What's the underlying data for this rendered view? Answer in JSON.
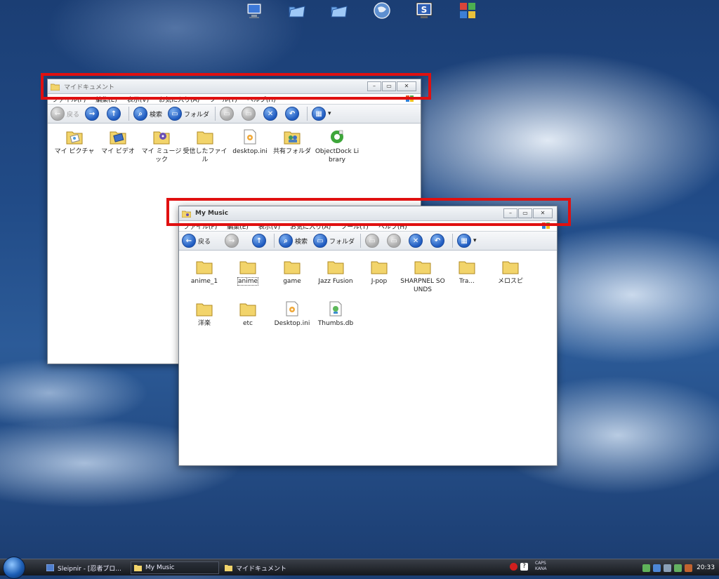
{
  "desktop": {
    "icons": [
      "computer-icon",
      "folder-blue-icon",
      "folder-blue-icon",
      "globe-icon",
      "app-s-icon",
      "apps-grid-icon"
    ]
  },
  "window_mydocs": {
    "title": "マイドキュメント",
    "menu": [
      "ファイル(F)",
      "編集(E)",
      "表示(V)",
      "お気に入り(A)",
      "ツール(T)",
      "ヘルプ(H)"
    ],
    "toolbar": {
      "back": "戻る",
      "search": "検索",
      "folders": "フォルダ"
    },
    "files": [
      {
        "name": "マイ ピクチャ",
        "icon": "pictures-folder-icon"
      },
      {
        "name": "マイ ビデオ",
        "icon": "videos-folder-icon"
      },
      {
        "name": "マイ ミュージック",
        "icon": "music-folder-icon"
      },
      {
        "name": "受信したファイル",
        "icon": "folder-icon"
      },
      {
        "name": "desktop.ini",
        "icon": "settings-file-icon"
      },
      {
        "name": "共有フォルダ",
        "icon": "shared-folder-icon"
      },
      {
        "name": "ObjectDock Library",
        "icon": "objectdock-icon"
      }
    ]
  },
  "window_mymusic": {
    "title": "My Music",
    "menu": [
      "ファイル(F)",
      "編集(E)",
      "表示(V)",
      "お気に入り(A)",
      "ツール(T)",
      "ヘルプ(H)"
    ],
    "toolbar": {
      "back": "戻る",
      "search": "検索",
      "folders": "フォルダ"
    },
    "files": [
      {
        "name": "anime_1",
        "icon": "folder-icon"
      },
      {
        "name": "anime",
        "icon": "folder-icon",
        "selected": true
      },
      {
        "name": "game",
        "icon": "folder-icon"
      },
      {
        "name": "Jazz Fusion",
        "icon": "folder-icon"
      },
      {
        "name": "J-pop",
        "icon": "folder-icon"
      },
      {
        "name": "SHARPNEL SOUNDS",
        "icon": "folder-icon"
      },
      {
        "name": "Tra...",
        "icon": "folder-icon"
      },
      {
        "name": "メロスピ",
        "icon": "folder-icon"
      },
      {
        "name": "洋楽",
        "icon": "folder-icon"
      },
      {
        "name": "etc",
        "icon": "folder-icon"
      },
      {
        "name": "Desktop.ini",
        "icon": "settings-file-icon"
      },
      {
        "name": "Thumbs.db",
        "icon": "thumbs-file-icon"
      }
    ]
  },
  "taskbar": {
    "tasks": [
      {
        "label": "Sleipnir - [忍者ブロ...",
        "icon": "browser-icon"
      },
      {
        "label": "My Music",
        "icon": "folder-icon",
        "active": true
      },
      {
        "label": "マイドキュメント",
        "icon": "folder-icon"
      }
    ],
    "caps_label": "CAPS",
    "kana_label": "KANA",
    "time": "20:33"
  },
  "colors": {
    "highlight_red": "#e01010",
    "folder_yellow": "#f2d46b"
  }
}
